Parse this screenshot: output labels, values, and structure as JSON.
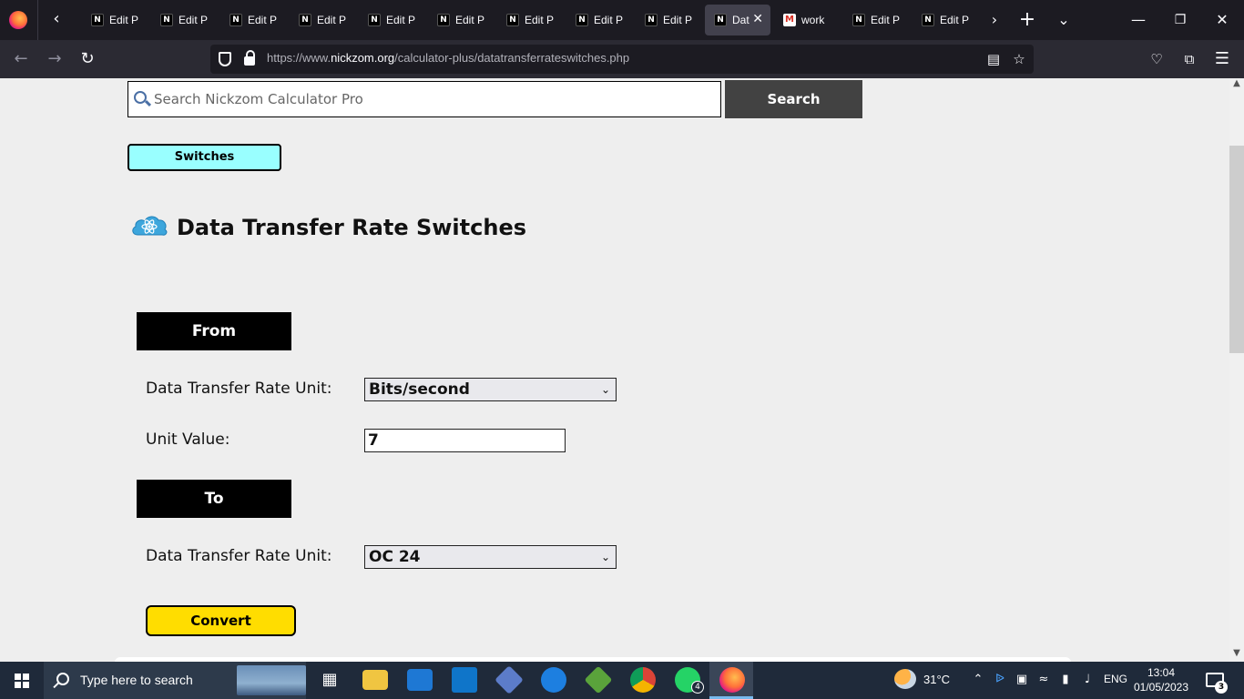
{
  "browser": {
    "tabs": [
      {
        "title": "Edit P",
        "icon": "nickzom-icon"
      },
      {
        "title": "Edit P",
        "icon": "nickzom-icon"
      },
      {
        "title": "Edit P",
        "icon": "nickzom-icon"
      },
      {
        "title": "Edit P",
        "icon": "nickzom-icon"
      },
      {
        "title": "Edit P",
        "icon": "nickzom-icon"
      },
      {
        "title": "Edit P",
        "icon": "nickzom-icon"
      },
      {
        "title": "Edit P",
        "icon": "nickzom-icon"
      },
      {
        "title": "Edit P",
        "icon": "nickzom-icon"
      },
      {
        "title": "Edit P",
        "icon": "nickzom-icon"
      },
      {
        "title": "Dat",
        "icon": "nickzom-icon",
        "active": true
      },
      {
        "title": "work",
        "icon": "gmail-icon"
      },
      {
        "title": "Edit P",
        "icon": "nickzom-icon"
      },
      {
        "title": "Edit P",
        "icon": "nickzom-icon"
      }
    ],
    "url_prefix": "https://www.",
    "url_host": "nickzom.org",
    "url_path": "/calculator-plus/datatransferrateswitches.php"
  },
  "page": {
    "search_placeholder": "Search Nickzom Calculator Pro",
    "search_button": "Search",
    "switches_button": "Switches",
    "title": "Data Transfer Rate Switches",
    "from_heading": "From",
    "from_unit_label": "Data Transfer Rate Unit:",
    "from_unit_value": "Bits/second",
    "unit_value_label": "Unit Value:",
    "unit_value": "7",
    "to_heading": "To",
    "to_unit_label": "Data Transfer Rate Unit:",
    "to_unit_value": "OC 24",
    "convert_button": "Convert"
  },
  "taskbar": {
    "search_text": "Type here to search",
    "weather": "31°C",
    "language": "ENG",
    "time": "13:04",
    "date": "01/05/2023",
    "whatsapp_badge": "4",
    "notification_count": "3"
  }
}
